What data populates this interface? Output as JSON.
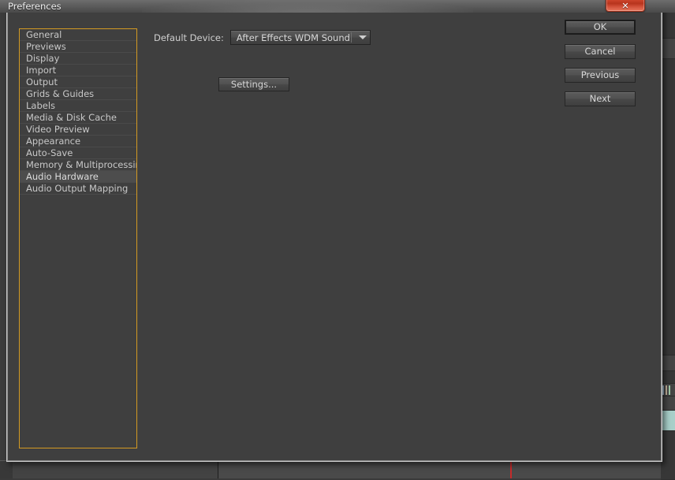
{
  "window": {
    "title": "Preferences",
    "close_glyph": "✕"
  },
  "sidebar": {
    "items": [
      {
        "label": "General",
        "selected": false
      },
      {
        "label": "Previews",
        "selected": false
      },
      {
        "label": "Display",
        "selected": false
      },
      {
        "label": "Import",
        "selected": false
      },
      {
        "label": "Output",
        "selected": false
      },
      {
        "label": "Grids & Guides",
        "selected": false
      },
      {
        "label": "Labels",
        "selected": false
      },
      {
        "label": "Media & Disk Cache",
        "selected": false
      },
      {
        "label": "Video Preview",
        "selected": false
      },
      {
        "label": "Appearance",
        "selected": false
      },
      {
        "label": "Auto-Save",
        "selected": false
      },
      {
        "label": "Memory & Multiprocessing",
        "selected": false
      },
      {
        "label": "Audio Hardware",
        "selected": true
      },
      {
        "label": "Audio Output Mapping",
        "selected": false
      }
    ]
  },
  "panel": {
    "device_label": "Default Device:",
    "device_value": "After Effects WDM Sound",
    "settings_label": "Settings..."
  },
  "actions": {
    "ok": "OK",
    "cancel": "Cancel",
    "previous": "Previous",
    "next": "Next"
  },
  "colors": {
    "dialog_background": "#3f3f3f",
    "listbox_focus_border": "#d49a23",
    "selected_item_background": "#4d4d4d",
    "text": "#c8c8c8",
    "close_button": "#b8341d",
    "playhead": "#c62b2b"
  }
}
